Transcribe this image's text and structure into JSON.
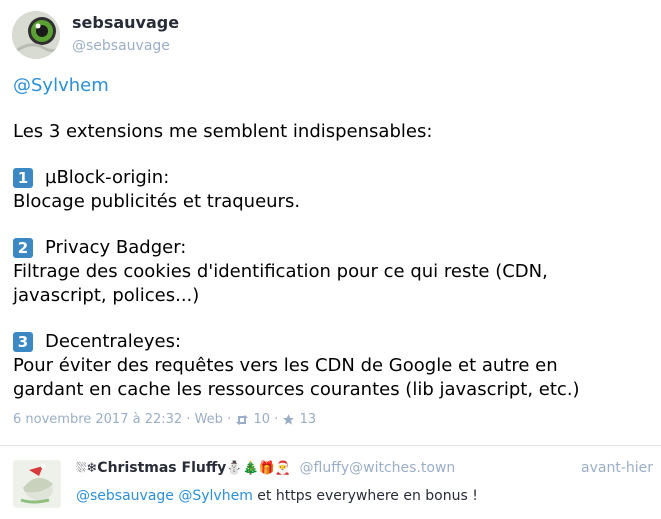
{
  "status": {
    "author": {
      "display_name": "sebsauvage",
      "handle": "@sebsauvage"
    },
    "mention": "@Sylvhem",
    "intro": "Les 3 extensions me semblent indispensables:",
    "items": [
      {
        "number": "1",
        "title": "µBlock-origin:",
        "description": "Blocage publicités et traqueurs."
      },
      {
        "number": "2",
        "title": "Privacy Badger:",
        "description_line1": "Filtrage des cookies d'identification pour ce qui reste (CDN,",
        "description_line2": "javascript, polices...)"
      },
      {
        "number": "3",
        "title": "Decentraleyes:",
        "description_line1": "Pour éviter des requêtes vers les CDN de Google et autre en",
        "description_line2": "gardant en cache les ressources courantes (lib javascript, etc.)"
      }
    ],
    "meta": {
      "timestamp": "6 novembre 2017 à 22:32",
      "separator": "·",
      "application": "Web",
      "boosts": "10",
      "favourites": "13"
    }
  },
  "reply": {
    "display_name_prefix": "⛆❄",
    "display_name": "Christmas Fluffy",
    "display_name_suffix": "⛄🎄🎁🎅",
    "handle": "@fluffy@witches.town",
    "time": "avant-hier",
    "mention1": "@sebsauvage",
    "mention2": "@Sylvhem",
    "text": " et https everywhere en bonus !"
  },
  "icons": {
    "boost": "retweet-icon",
    "favourite": "star-icon"
  },
  "colors": {
    "link": "#2b90d9",
    "muted": "#9baec8",
    "number_badge": "#3b88c3"
  }
}
